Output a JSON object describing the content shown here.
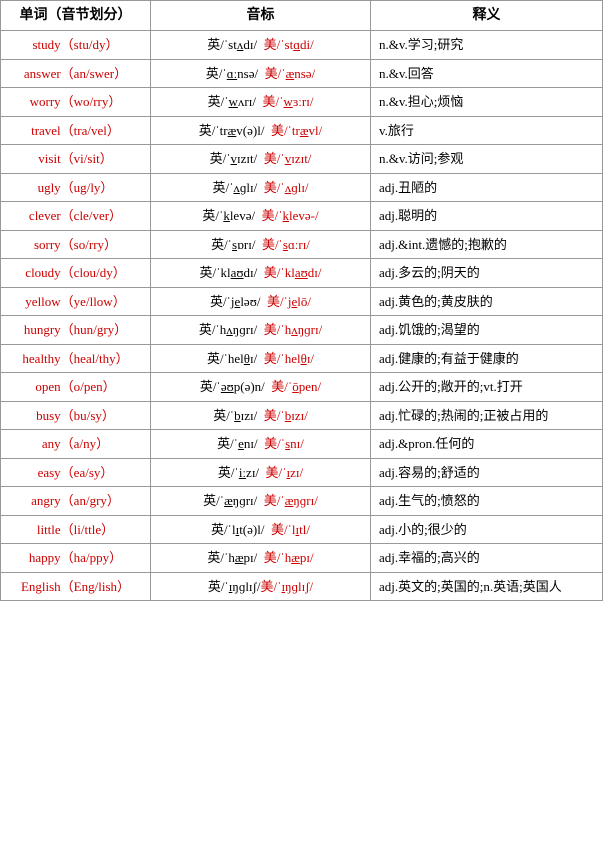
{
  "table": {
    "headers": [
      "单词（音节划分）",
      "音标",
      "释义"
    ],
    "rows": [
      {
        "word": "study（stu/dy）",
        "phonetic": "英/ˈstʌdɪ/  美/ˈstɑdi/",
        "phonetic_html": "<span>英/ˈst<u>ʌ</u>dɪ/</span>&nbsp;&nbsp;<span style='color:#c00'>美/ˈst<u>ɑ</u>di/</span>",
        "meaning": "n.&v.学习;研究"
      },
      {
        "word": "answer（an/swer）",
        "phonetic": "英/ˈɑːnsə/  美/ˈænsə/",
        "phonetic_html": "<span>英/ˈ<u>ɑː</u>nsə/</span>&nbsp;&nbsp;<span style='color:#c00'>美/ˈ<u>æ</u>nsə/</span>",
        "meaning": "n.&v.回答"
      },
      {
        "word": "worry（wo/rry）",
        "phonetic": "英/ˈwʌrɪ/  美/ˈwɜːrɪ/",
        "phonetic_html": "<span>英/ˈ<u>w</u>ʌrɪ/</span>&nbsp;&nbsp;<span style='color:#c00'>美/ˈ<u>w</u>ɜːrɪ/</span>",
        "meaning": "n.&v.担心;烦恼"
      },
      {
        "word": "travel（tra/vel）",
        "phonetic": "英/ˈtræv(ə)l/  美/ˈtrævl/",
        "phonetic_html": "<span>英/ˈtr<u>æ</u>v(ə)l/</span>&nbsp;&nbsp;<span style='color:#c00'>美/ˈtr<u>æ</u>vl/</span>",
        "meaning": "v.旅行"
      },
      {
        "word": "visit（vi/sit）",
        "phonetic": "英/ˈvɪzɪt/  美/ˈvɪzɪt/",
        "phonetic_html": "<span>英/ˈ<u>v</u>ɪzɪt/</span>&nbsp;&nbsp;<span style='color:#c00'>美/ˈ<u>v</u>ɪzɪt/</span>",
        "meaning": "n.&v.访问;参观"
      },
      {
        "word": "ugly（ug/ly）",
        "phonetic": "英/ˈʌɡlɪ/  美/ˈʌɡlɪ/",
        "phonetic_html": "<span>英/ˈ<u>ʌ</u>ɡlɪ/</span>&nbsp;&nbsp;<span style='color:#c00'>美/ˈ<u>ʌ</u>ɡlɪ/</span>",
        "meaning": "adj.丑陋的"
      },
      {
        "word": "clever（cle/ver）",
        "phonetic": "英/ˈklevə/  美/ˈklevə-/",
        "phonetic_html": "<span>英/ˈ<u>k</u>levə/</span>&nbsp;&nbsp;<span style='color:#c00'>美/ˈ<u>k</u>levə-/</span>",
        "meaning": "adj.聪明的"
      },
      {
        "word": "sorry（so/rry）",
        "phonetic": "英/ˈsɒrɪ/  美/ˈsɑːrɪ/",
        "phonetic_html": "<span>英/ˈ<u>s</u>ɒrɪ/</span>&nbsp;&nbsp;<span style='color:#c00'>美/ˈ<u>s</u>ɑːrɪ/</span>",
        "meaning": "adj.&int.遗憾的;抱歉的"
      },
      {
        "word": "cloudy（clou/dy）",
        "phonetic": "英/ˈklaʊdɪ/  美/ˈklaʊdɪ/",
        "phonetic_html": "<span>英/ˈkl<u>aʊ</u>dɪ/</span>&nbsp;&nbsp;<span style='color:#c00'>美/ˈkl<u>aʊ</u>dɪ/</span>",
        "meaning": "adj.多云的;阴天的"
      },
      {
        "word": "yellow（ye/llow）",
        "phonetic": "英/ˈjeləʊ/  美/ˈjelō/",
        "phonetic_html": "<span>英/ˈj<u>e</u>ləʊ/</span>&nbsp;&nbsp;<span style='color:#c00'>美/ˈj<u>e</u>lō/</span>",
        "meaning": "adj.黄色的;黄皮肤的"
      },
      {
        "word": "hungry（hun/gry）",
        "phonetic": "英/ˈhʌŋɡrɪ/  美/ˈhʌŋɡrɪ/",
        "phonetic_html": "<span>英/ˈh<u>ʌ</u>ŋɡrɪ/</span>&nbsp;&nbsp;<span style='color:#c00'>美/ˈh<u>ʌ</u>ŋɡrɪ/</span>",
        "meaning": "adj.饥饿的;渴望的"
      },
      {
        "word": "healthy（heal/thy）",
        "phonetic": "英/ˈhelθɪ/  美/ˈhelθɪ/",
        "phonetic_html": "<span>英/ˈhel<u>θ</u>ɪ/</span>&nbsp;&nbsp;<span style='color:#c00'>美/ˈhel<u>θ</u>ɪ/</span>",
        "meaning": "adj.健康的;有益于健康的"
      },
      {
        "word": "open（o/pen）",
        "phonetic": "英/ˈəʊp(ə)n/  美/ˈōpen/",
        "phonetic_html": "<span>英/ˈ<u>əʊ</u>p(ə)n/</span>&nbsp;&nbsp;<span style='color:#c00'>美/ˈ<u>ō</u>pen/</span>",
        "meaning": "adj.公开的;敞开的;vt.打开"
      },
      {
        "word": "busy（bu/sy）",
        "phonetic": "英/ˈbɪzɪ/  美/ˈbɪzɪ/",
        "phonetic_html": "<span>英/ˈ<u>b</u>ɪzɪ/</span>&nbsp;&nbsp;<span style='color:#c00'>美/ˈ<u>b</u>ɪzɪ/</span>",
        "meaning": "adj.忙碌的;热闹的;正被占用的"
      },
      {
        "word": "any（a/ny）",
        "phonetic": "英/ˈenɪ/  美/ˈsnɪ/",
        "phonetic_html": "<span>英/ˈ<u>e</u>nɪ/</span>&nbsp;&nbsp;<span style='color:#c00'>美/ˈ<u>s</u>nɪ/</span>",
        "meaning": "adj.&pron.任何的"
      },
      {
        "word": "easy（ea/sy）",
        "phonetic": "英/ˈiːzɪ/  美/ˈɪzɪ/",
        "phonetic_html": "<span>英/ˈ<u>iː</u>zɪ/</span>&nbsp;&nbsp;<span style='color:#c00'>美/ˈ<u>ɪ</u>zɪ/</span>",
        "meaning": "adj.容易的;舒适的"
      },
      {
        "word": "angry（an/gry）",
        "phonetic": "英/ˈæŋɡrɪ/  美/ˈæŋɡrɪ/",
        "phonetic_html": "<span>英/ˈ<u>æ</u>ŋɡrɪ/</span>&nbsp;&nbsp;<span style='color:#c00'>美/ˈ<u>æ</u>ŋɡrɪ/</span>",
        "meaning": "adj.生气的;愤怒的"
      },
      {
        "word": "little（li/ttle）",
        "phonetic": "英/ˈlɪt(ə)l/  美/ˈlɪtl/",
        "phonetic_html": "<span>英/ˈl<u>ɪ</u>t(ə)l/</span>&nbsp;&nbsp;<span style='color:#c00'>美/ˈl<u>ɪ</u>tl/</span>",
        "meaning": "adj.小的;很少的"
      },
      {
        "word": "happy（ha/ppy）",
        "phonetic": "英/ˈhæpɪ/  美/ˈhæpɪ/",
        "phonetic_html": "<span>英/ˈh<u>æ</u>pɪ/</span>&nbsp;&nbsp;<span style='color:#c00'>美/ˈh<u>æ</u>pɪ/</span>",
        "meaning": "adj.幸福的;高兴的"
      },
      {
        "word": "English（Eng/lish）",
        "phonetic": "英/ˈɪŋɡlɪʃ/美/ˈɪŋɡlɪʃ/",
        "phonetic_html": "<span>英/ˈ<u>ɪ</u>ŋɡlɪʃ/</span><span style='color:#c00'>美/ˈ<u>ɪ</u>ŋɡlɪʃ/</span>",
        "meaning": "adj.英文的;英国的;n.英语;英国人"
      }
    ]
  }
}
